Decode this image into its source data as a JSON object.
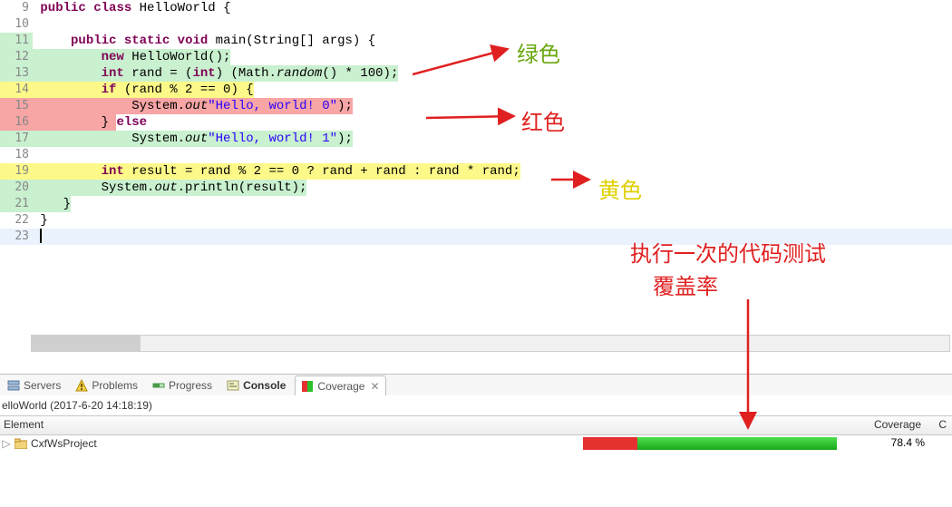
{
  "editor": {
    "lines": [
      {
        "no": 9
      },
      {
        "no": 10
      },
      {
        "no": 11
      },
      {
        "no": 12
      },
      {
        "no": 13
      },
      {
        "no": 14
      },
      {
        "no": 15
      },
      {
        "no": 16
      },
      {
        "no": 17
      },
      {
        "no": 18
      },
      {
        "no": 19
      },
      {
        "no": 20
      },
      {
        "no": 21
      },
      {
        "no": 22
      },
      {
        "no": 23
      }
    ],
    "tokens": {
      "kw_public": "public",
      "kw_class": "class",
      "cls": "HelloWorld",
      "ob": " {",
      "kw_static": "static",
      "kw_void": "void",
      "main": " main(String[] args) {",
      "kw_new": "new",
      "ctor": " HelloWorld();",
      "kw_int": "int",
      "rand_eq": " rand = (",
      "kw_int2": "int",
      "rand_tail": ") (Math.",
      "random": "random",
      "rand_end": "() * 100);",
      "kw_if": "if",
      "if_cond": " (rand % 2 == 0) {",
      "sysout": "System.",
      "out": "out",
      ".print": ".println(",
      "str0": "\"Hello, world! 0\"",
      "cparen": ");",
      "cb": "} ",
      "kw_else": "else",
      "str1": "\"Hello, world! 1\"",
      "res_decl": " result = rand % 2 == 0 ? rand + rand : rand * rand;",
      "print_res": ".println(result);",
      "cb_line": "    }",
      "cb2": "}"
    }
  },
  "tabs": {
    "servers": "Servers",
    "problems": "Problems",
    "progress": "Progress",
    "console": "Console",
    "coverage": "Coverage"
  },
  "coverage": {
    "session": "elloWorld (2017-6-20 14:18:19)",
    "header_element": "Element",
    "header_coverage": "Coverage",
    "header_c": "C",
    "project": "CxfWsProject",
    "pct": "78.4 %",
    "red_ratio": 0.216,
    "green_ratio": 0.784
  },
  "annotations": {
    "green": "绿色",
    "red": "红色",
    "yellow": "黄色",
    "coverage_note_line1": "执行一次的代码测试",
    "coverage_note_line2": "覆盖率"
  }
}
